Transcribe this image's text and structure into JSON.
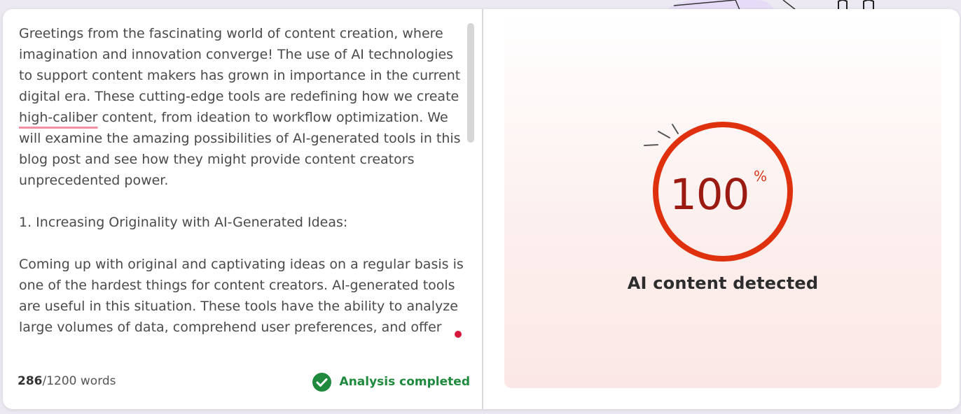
{
  "editor": {
    "paragraphs": {
      "p1_before": "Greetings from the fascinating world of content creation, where imagination and innovation converge! The use of AI technologies to support content makers has grown in importance in the current digital era. These cutting-edge tools are redefining how we create ",
      "p1_highlight": "high-caliber",
      "p1_after": " content, from ideation to workflow optimization. We will examine the amazing possibilities of AI-generated tools in this blog post and see how they might provide content creators unprecedented power.",
      "p2": "1. Increasing Originality with AI-Generated Ideas:",
      "p3": "Coming up with original and captivating ideas on a regular basis is one of the hardest things for content creators. AI-generated tools are useful in this situation. These tools have the ability to analyze large volumes of data, comprehend user preferences, and offer"
    }
  },
  "footer": {
    "word_count_current": "286",
    "word_count_total": "/1200 words",
    "status_label": "Analysis completed",
    "status_icon": "check-circle-icon",
    "status_color": "#1f8a3e"
  },
  "result": {
    "percent": "100",
    "percent_sign": "%",
    "label": "AI content detected",
    "gauge_fill": 1.0,
    "gauge_color": "#e0310f"
  }
}
